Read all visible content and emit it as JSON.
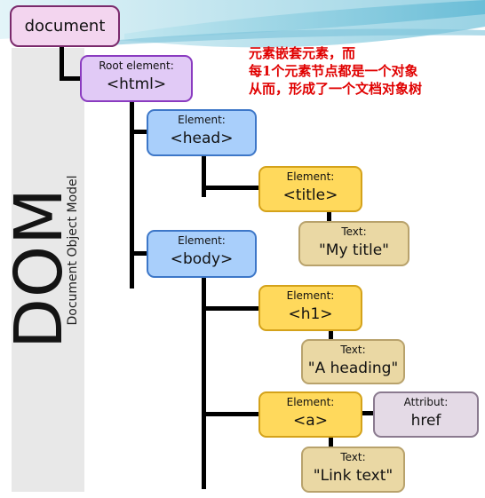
{
  "side_title": "DOM",
  "side_subtitle": "Document Object Model",
  "annotation": [
    "元素嵌套元素，而",
    "每1个元素节点都是一个对象",
    "从而，形成了一个文档对象树"
  ],
  "colors": {
    "annotation": "#e00000",
    "element_blue": "#a9cffb",
    "element_yellow": "#ffd95c",
    "text_node": "#ead8a4",
    "root": "#e1caf6",
    "document": "#f3d5ef",
    "attribute": "#e4dae6"
  },
  "nodes": {
    "document": {
      "value": "document"
    },
    "html": {
      "label": "Root element:",
      "value": "<html>"
    },
    "head": {
      "label": "Element:",
      "value": "<head>"
    },
    "title": {
      "label": "Element:",
      "value": "<title>"
    },
    "title_text": {
      "label": "Text:",
      "value": "\"My title\""
    },
    "body": {
      "label": "Element:",
      "value": "<body>"
    },
    "h1": {
      "label": "Element:",
      "value": "<h1>"
    },
    "h1_text": {
      "label": "Text:",
      "value": "\"A heading\""
    },
    "a": {
      "label": "Element:",
      "value": "<a>"
    },
    "a_attr": {
      "label": "Attribut:",
      "value": "href"
    },
    "a_text": {
      "label": "Text:",
      "value": "\"Link text\""
    }
  }
}
